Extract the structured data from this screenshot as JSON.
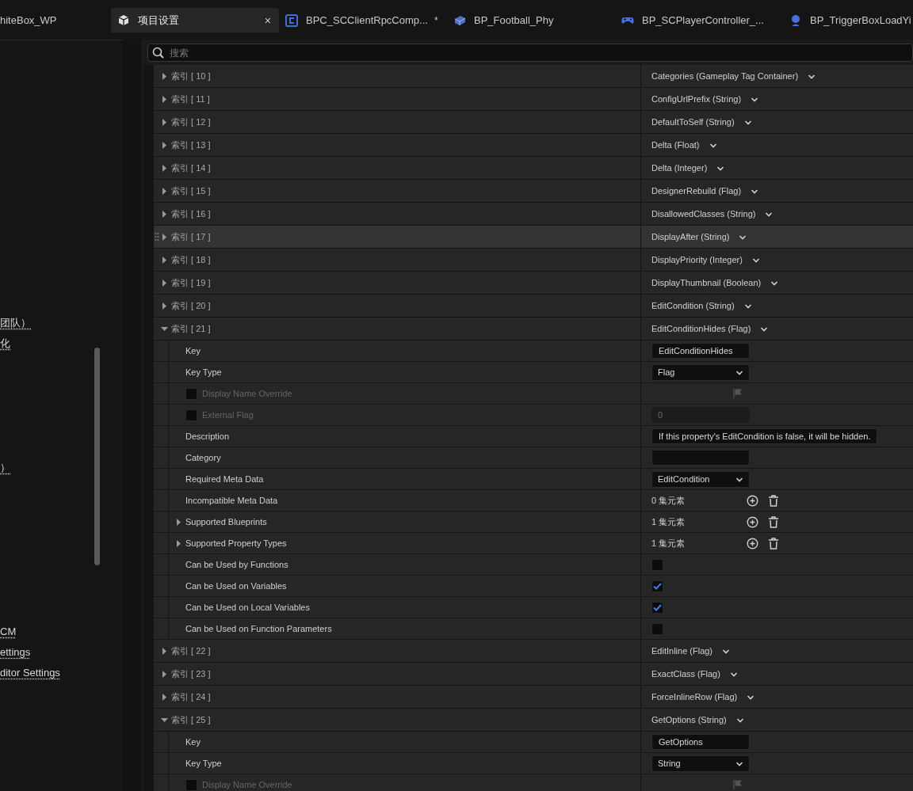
{
  "tabs": [
    {
      "label": "hiteBox_WP",
      "selected": false
    },
    {
      "label": "项目设置",
      "selected": true,
      "close": "×"
    },
    {
      "label": "BPC_SCClientRpcComp...",
      "selected": false,
      "dirty_mark": "*"
    },
    {
      "label": "BP_Football_Phy",
      "selected": false
    },
    {
      "label": "BP_SCPlayerController_...",
      "selected": false
    },
    {
      "label": "BP_TriggerBoxLoadYi",
      "selected": false
    }
  ],
  "sidebar": {
    "links": [
      "团队）",
      "化",
      "）",
      "CM",
      "ettings",
      "ditor Settings"
    ]
  },
  "search": {
    "placeholder": "搜索"
  },
  "entries": [
    {
      "label": "索引 [ 10 ]",
      "value": "Categories (Gameplay Tag Container)",
      "expanded": false,
      "hovered": false
    },
    {
      "label": "索引 [ 11 ]",
      "value": "ConfigUrlPrefix (String)",
      "expanded": false,
      "hovered": false
    },
    {
      "label": "索引 [ 12 ]",
      "value": "DefaultToSelf (String)",
      "expanded": false,
      "hovered": false
    },
    {
      "label": "索引 [ 13 ]",
      "value": "Delta (Float)",
      "expanded": false,
      "hovered": false
    },
    {
      "label": "索引 [ 14 ]",
      "value": "Delta (Integer)",
      "expanded": false,
      "hovered": false
    },
    {
      "label": "索引 [ 15 ]",
      "value": "DesignerRebuild (Flag)",
      "expanded": false,
      "hovered": false
    },
    {
      "label": "索引 [ 16 ]",
      "value": "DisallowedClasses (String)",
      "expanded": false,
      "hovered": false
    },
    {
      "label": "索引 [ 17 ]",
      "value": "DisplayAfter (String)",
      "expanded": false,
      "hovered": true
    },
    {
      "label": "索引 [ 18 ]",
      "value": "DisplayPriority (Integer)",
      "expanded": false,
      "hovered": false
    },
    {
      "label": "索引 [ 19 ]",
      "value": "DisplayThumbnail (Boolean)",
      "expanded": false,
      "hovered": false
    },
    {
      "label": "索引 [ 20 ]",
      "value": "EditCondition (String)",
      "expanded": false,
      "hovered": false
    },
    {
      "label": "索引 [ 21 ]",
      "value": "EditConditionHides (Flag)",
      "expanded": true,
      "hovered": false,
      "children": [
        {
          "kind": "text",
          "label": "Key",
          "value": "EditConditionHides"
        },
        {
          "kind": "dropdown",
          "label": "Key Type",
          "value": "Flag"
        },
        {
          "kind": "override",
          "label": "Display Name Override",
          "checked": false,
          "disabled": true
        },
        {
          "kind": "number",
          "label": "External Flag",
          "checked": false,
          "disabled": true,
          "value": "0"
        },
        {
          "kind": "text",
          "label": "Description",
          "value": "If this property's EditCondition is false, it will be hidden."
        },
        {
          "kind": "text",
          "label": "Category"
        },
        {
          "kind": "dropdown",
          "label": "Required Meta Data",
          "value": "EditCondition"
        },
        {
          "kind": "array",
          "label": "Incompatible Meta Data",
          "value": "0 集元素"
        },
        {
          "kind": "array",
          "label": "Supported Blueprints",
          "value": "1 集元素",
          "expanded": false
        },
        {
          "kind": "array",
          "label": "Supported Property Types",
          "value": "1 集元素",
          "expanded": false
        },
        {
          "kind": "bool",
          "label": "Can be Used by Functions",
          "checked": false
        },
        {
          "kind": "bool",
          "label": "Can be Used on Variables",
          "checked": true
        },
        {
          "kind": "bool",
          "label": "Can be Used on Local Variables",
          "checked": true
        },
        {
          "kind": "bool",
          "label": "Can be Used on Function Parameters",
          "checked": false
        }
      ]
    },
    {
      "label": "索引 [ 22 ]",
      "value": "EditInline (Flag)",
      "expanded": false,
      "hovered": false
    },
    {
      "label": "索引 [ 23 ]",
      "value": "ExactClass (Flag)",
      "expanded": false,
      "hovered": false
    },
    {
      "label": "索引 [ 24 ]",
      "value": "ForceInlineRow (Flag)",
      "expanded": false,
      "hovered": false
    },
    {
      "label": "索引 [ 25 ]",
      "value": "GetOptions (String)",
      "expanded": true,
      "hovered": false,
      "children": [
        {
          "kind": "text",
          "label": "Key",
          "value": "GetOptions"
        },
        {
          "kind": "dropdown",
          "label": "Key Type",
          "value": "String"
        },
        {
          "kind": "override",
          "label": "Display Name Override",
          "checked": false,
          "disabled": true
        }
      ]
    }
  ]
}
